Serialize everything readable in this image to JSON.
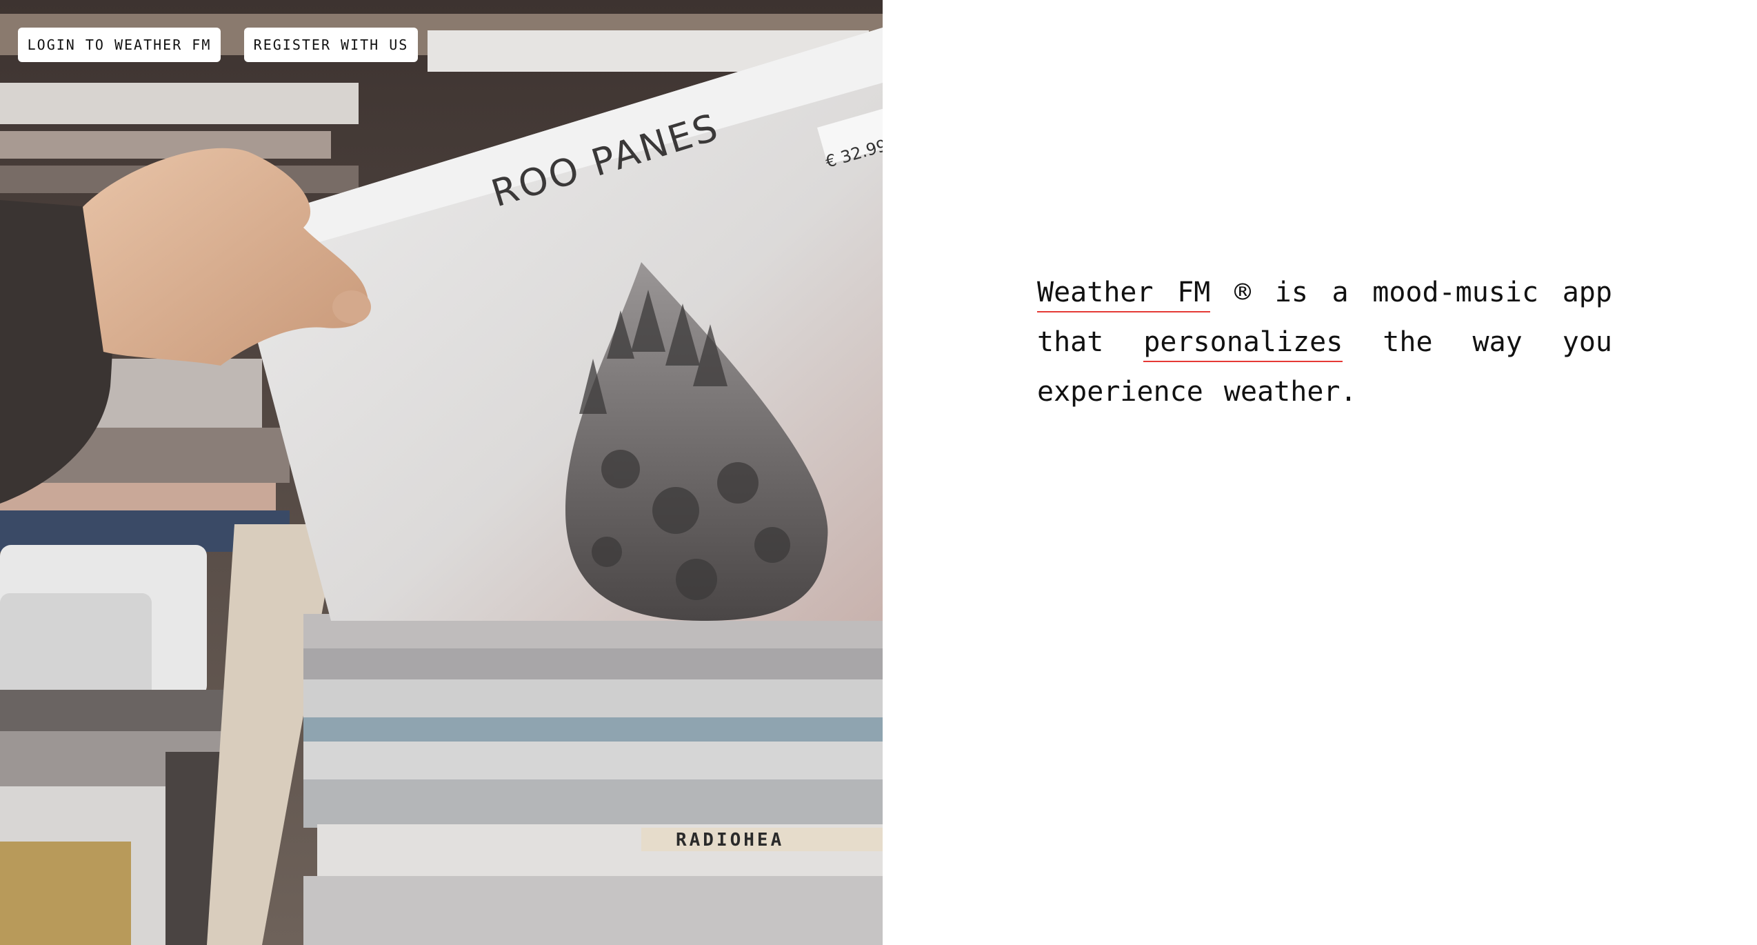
{
  "nav": {
    "login_label": "LOGIN TO WEATHER FM",
    "register_label": "REGISTER WITH US"
  },
  "hero": {
    "image_sleeve_title": "ROO PANES",
    "price_sticker": "€ 32.99",
    "divider_label": "RADIOHEA"
  },
  "tagline": {
    "brand_link": "Weather FM",
    "mark": "®",
    "text_1": "is a mood-music app that",
    "personalize_link": "personalizes",
    "text_2": "the way you experience weather."
  },
  "colors": {
    "link_underline": "#e53935",
    "text": "#111111",
    "background": "#ffffff"
  }
}
